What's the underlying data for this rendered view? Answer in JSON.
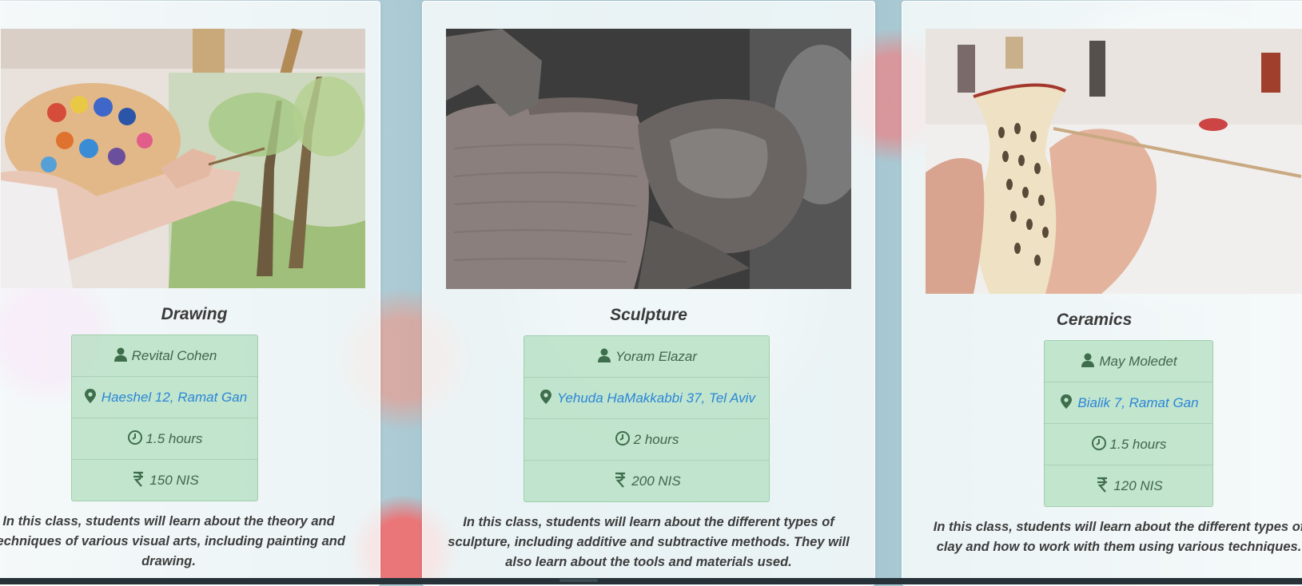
{
  "classes": [
    {
      "title": "Drawing",
      "image_alt": "painter painting a tree on canvas holding a palette",
      "teacher": "Revital Cohen",
      "address": "Haeshel 12, Ramat Gan",
      "duration": "1.5 hours",
      "price": "150 NIS",
      "description": "In this class, students will learn about the theory and techniques of various visual arts, including painting and drawing."
    },
    {
      "title": "Sculpture",
      "image_alt": "clay-covered hands shaping a pot on a potter's wheel",
      "teacher": "Yoram Elazar",
      "address": "Yehuda HaMakkabbi 37, Tel Aviv",
      "duration": "2 hours",
      "price": "200 NIS",
      "description": "In this class, students will learn about the different types of sculpture, including additive and subtractive methods. They will also learn about the tools and materials used."
    },
    {
      "title": "Ceramics",
      "image_alt": "hands painting a pattern on a ceramic vase",
      "teacher": "May Moledet",
      "address": "Bialik 7, Ramat Gan",
      "duration": "1.5 hours",
      "price": "120 NIS",
      "description": "In this class, students will learn about the different types of clay and how to work with them using various techniques."
    }
  ],
  "icons": {
    "teacher": "user-icon",
    "address": "map-marker-icon",
    "duration": "clock-icon",
    "price": "rupee-icon"
  },
  "colors": {
    "info_box_bg": "#b0debe",
    "info_text": "#40664c",
    "link": "#2b86d6",
    "title": "#3a3a3a"
  }
}
